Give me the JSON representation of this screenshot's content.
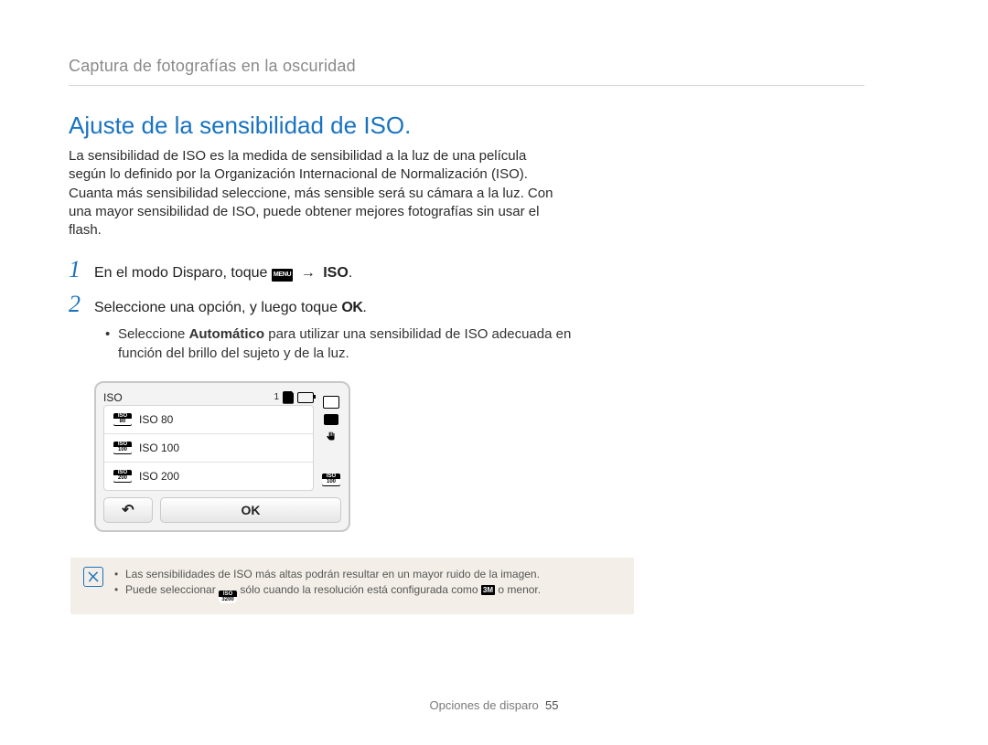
{
  "breadcrumb": "Captura de fotografías en la oscuridad",
  "section_title": "Ajuste de la sensibilidad de ISO.",
  "intro": "La sensibilidad de ISO es la medida de sensibilidad a la luz de una película según lo definido por la Organización Internacional de Normalización (ISO). Cuanta más sensibilidad seleccione, más sensible será su cámara a la luz. Con una mayor sensibilidad de ISO, puede obtener mejores fotografías sin usar el flash.",
  "steps": [
    {
      "num": "1",
      "pre": "En el modo Disparo, toque ",
      "menu_chip": "MENU",
      "arrow": " → ",
      "suffix_bold": "ISO",
      "post": "."
    },
    {
      "num": "2",
      "pre": "Seleccione una opción, y luego toque ",
      "ok_glyph": "OK",
      "post": "."
    }
  ],
  "step2_bullet": {
    "pre": "Seleccione ",
    "bold": "Automático",
    "post": " para utilizar una sensibilidad de ISO adecuada en función del brillo del sujeto y de la luz."
  },
  "device": {
    "title": "ISO",
    "counter": "1",
    "items": [
      {
        "badge_top": "ISO",
        "badge_bot": "80",
        "label": "ISO 80",
        "selected": false
      },
      {
        "badge_top": "ISO",
        "badge_bot": "100",
        "label": "ISO 100",
        "selected": true
      },
      {
        "badge_top": "ISO",
        "badge_bot": "200",
        "label": "ISO 200",
        "selected": false
      }
    ],
    "side_bottom_badge": {
      "top": "ISO",
      "bot": "100"
    },
    "back_label": "↶",
    "ok_label": "OK"
  },
  "notes": [
    {
      "text": "Las sensibilidades de ISO más altas podrán resultar en un mayor ruido de la imagen."
    },
    {
      "pre": "Puede seleccionar ",
      "badge": {
        "top": "ISO",
        "bot": "3200"
      },
      "mid": " sólo cuando la resolución está configurada como ",
      "three_m": "3M",
      "post": " o menor."
    }
  ],
  "footer": {
    "label": "Opciones de disparo",
    "page": "55"
  }
}
